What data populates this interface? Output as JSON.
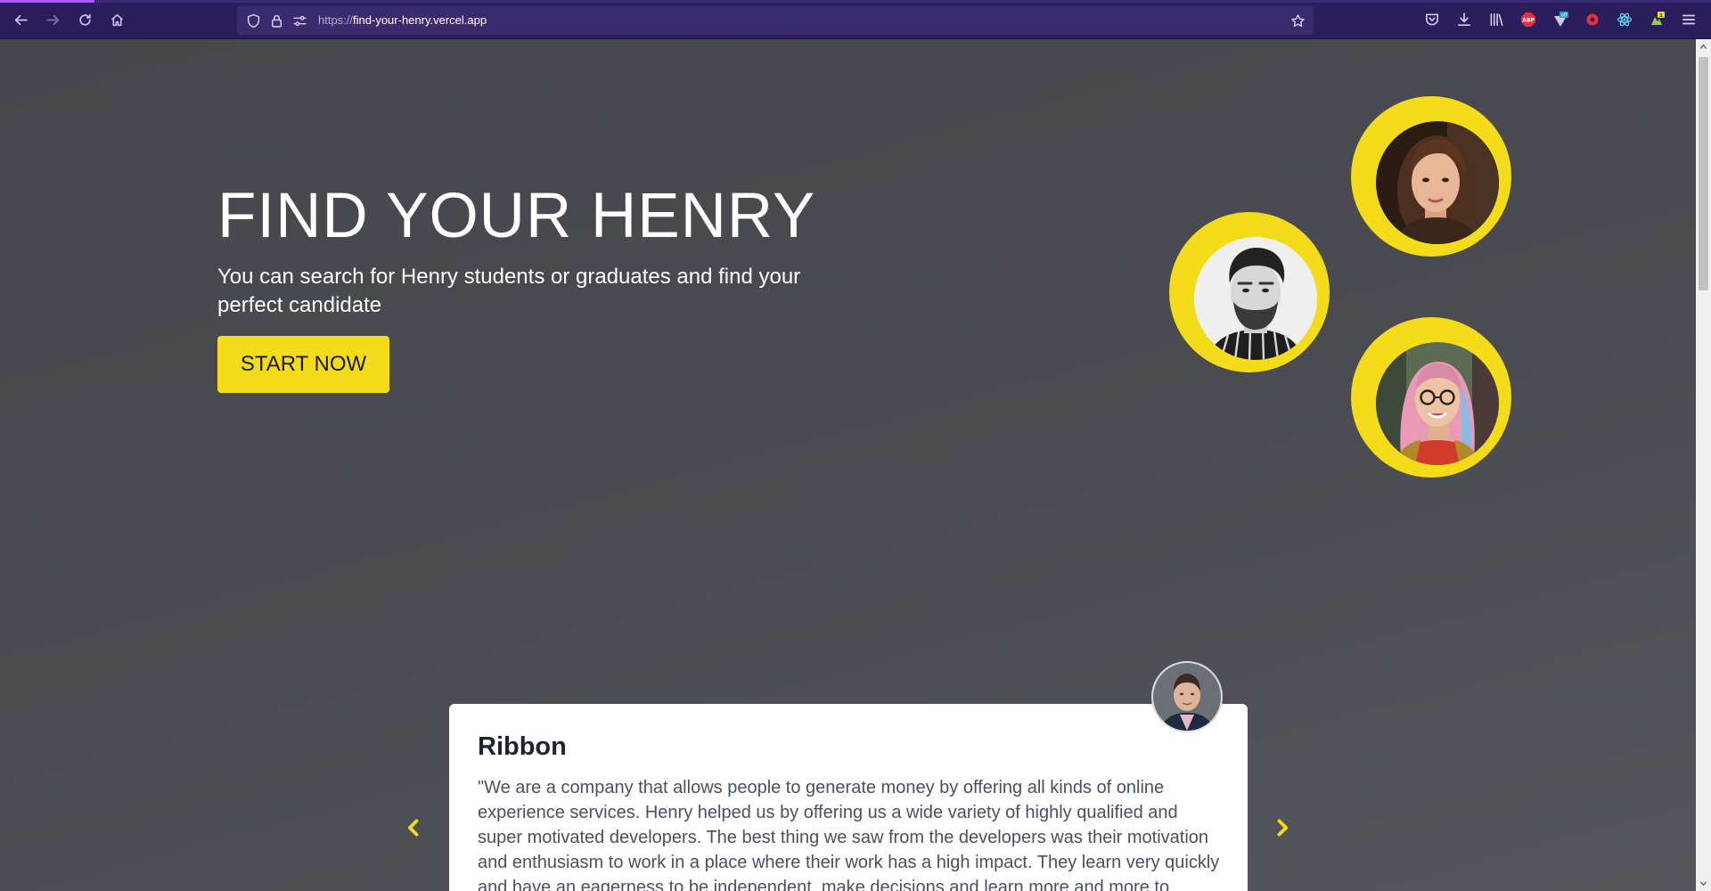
{
  "browser": {
    "url_scheme": "https://",
    "url_host": "find-your-henry.vercel.app",
    "theme_color": "#2b1e5c",
    "icons": [
      "back-arrow-icon",
      "forward-arrow-icon",
      "reload-icon",
      "home-icon",
      "shield-icon",
      "lock-icon",
      "permissions-icon",
      "bookmark-star-icon",
      "pocket-icon",
      "download-icon",
      "library-icon",
      "adblock-icon",
      "extension-off-icon",
      "record-icon",
      "react-devtools-icon",
      "extension-badge-icon",
      "menu-icon"
    ],
    "extensions": {
      "adblock_label": "ABP",
      "off_badge": "off",
      "notification_badge": "1"
    }
  },
  "hero": {
    "title": "FIND YOUR HENRY",
    "subtitle": "You can search for Henry students or graduates and find your perfect candidate",
    "cta_label": "START NOW",
    "accent_color": "#f5dc1b"
  },
  "testimonial": {
    "name": "Ribbon",
    "quote": "\"We are a company that allows people to generate money by offering all kinds of online experience services. Henry helped us by offering us a wide variety of highly qualified and super motivated developers. The best thing we saw from the developers was their motivation and enthusiasm to work in a place where their work has a high impact. They learn very quickly and have an eagerness to be independent, make decisions and learn more and more to"
  }
}
